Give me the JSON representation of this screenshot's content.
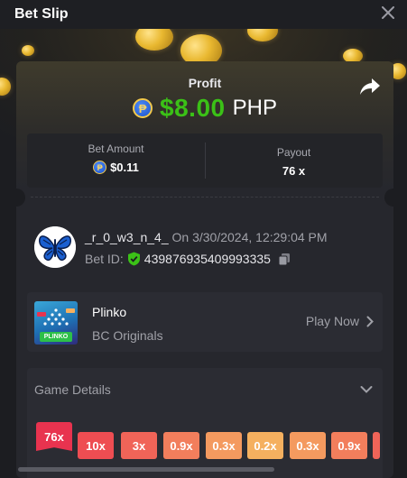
{
  "window": {
    "title": "Bet Slip"
  },
  "summary": {
    "profit_label": "Profit",
    "currency_symbol": "₱",
    "profit_amount": "$8.00",
    "profit_currency": "PHP",
    "bet_amount_label": "Bet Amount",
    "bet_amount": "$0.11",
    "payout_label": "Payout",
    "payout": "76 x"
  },
  "player": {
    "username": "_r_0_w3_n_4_",
    "date_text": "On 3/30/2024, 12:29:04 PM",
    "bet_id_label": "Bet ID:",
    "bet_id": "439876935409993335"
  },
  "game": {
    "name": "Plinko",
    "provider": "BC Originals",
    "play_label": "Play Now",
    "thumb_text": "PLINKO"
  },
  "details": {
    "title": "Game Details",
    "multipliers": [
      {
        "label": "76x",
        "color": "#e8334f",
        "active": true
      },
      {
        "label": "10x",
        "color": "#ee4d52"
      },
      {
        "label": "3x",
        "color": "#f06458"
      },
      {
        "label": "0.9x",
        "color": "#f27e5c"
      },
      {
        "label": "0.3x",
        "color": "#f49a5f"
      },
      {
        "label": "0.2x",
        "color": "#f5b05f"
      },
      {
        "label": "0.3x",
        "color": "#f49a5f"
      },
      {
        "label": "0.9x",
        "color": "#f27e5c"
      },
      {
        "label": "",
        "color": "#f06458"
      }
    ]
  },
  "colors": {
    "profit_green": "#3bc117",
    "background": "#1c1d21",
    "card": "#26272d"
  }
}
